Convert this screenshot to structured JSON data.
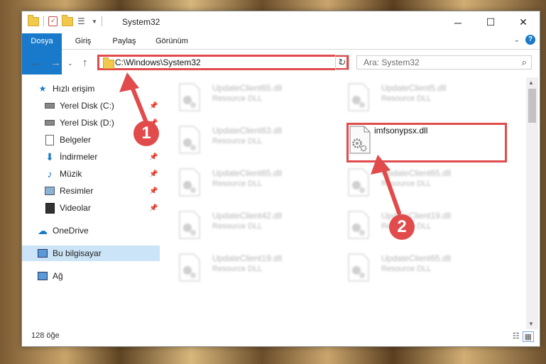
{
  "window": {
    "title": "System32"
  },
  "ribbon": {
    "tabs": [
      "Dosya",
      "Giriş",
      "Paylaş",
      "Görünüm"
    ]
  },
  "address": {
    "path": "C:\\Windows\\System32"
  },
  "search": {
    "placeholder": "Ara: System32"
  },
  "sidebar": {
    "items": [
      {
        "label": "Hızlı erişim",
        "icon": "star-icon",
        "pinned": false
      },
      {
        "label": "Yerel Disk (C:)",
        "icon": "drive-icon",
        "pinned": true
      },
      {
        "label": "Yerel Disk (D:)",
        "icon": "drive-icon",
        "pinned": true
      },
      {
        "label": "Belgeler",
        "icon": "documents-icon",
        "pinned": true
      },
      {
        "label": "İndirmeler",
        "icon": "download-icon",
        "pinned": true
      },
      {
        "label": "Müzik",
        "icon": "music-icon",
        "pinned": true
      },
      {
        "label": "Resimler",
        "icon": "pictures-icon",
        "pinned": true
      },
      {
        "label": "Videolar",
        "icon": "video-icon",
        "pinned": true
      },
      {
        "label": "OneDrive",
        "icon": "cloud-icon",
        "pinned": false
      },
      {
        "label": "Bu bilgisayar",
        "icon": "computer-icon",
        "pinned": false
      },
      {
        "label": "Ağ",
        "icon": "network-icon",
        "pinned": false
      }
    ]
  },
  "files": [
    {
      "name": "UpdateClient65.dll",
      "type": "Resource DLL",
      "blurred": true
    },
    {
      "name": "UpdateClient5.dll",
      "type": "Resource DLL",
      "blurred": true
    },
    {
      "name": "UpdateClient63.dll",
      "type": "Resource DLL",
      "blurred": true
    },
    {
      "name": "imfsonypsx.dll",
      "type": "",
      "blurred": false
    },
    {
      "name": "UpdateClient65.dll",
      "type": "Resource DLL",
      "blurred": true
    },
    {
      "name": "UpdateClient65.dll",
      "type": "Resource DLL",
      "blurred": true
    },
    {
      "name": "UpdateClient42.dll",
      "type": "Resource DLL",
      "blurred": true
    },
    {
      "name": "UpdateClient19.dll",
      "type": "Resource DLL",
      "blurred": true
    },
    {
      "name": "UpdateClient19.dll",
      "type": "Resource DLL",
      "blurred": true
    },
    {
      "name": "UpdateClient65.dll",
      "type": "Resource DLL",
      "blurred": true
    }
  ],
  "status": {
    "item_count": "128 öğe"
  },
  "annotations": {
    "step1": "1",
    "step2": "2",
    "color": "#e14b4b"
  }
}
